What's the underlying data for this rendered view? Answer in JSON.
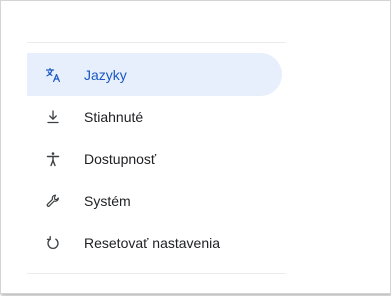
{
  "menu": {
    "items": [
      {
        "label": "Jazyky",
        "icon": "translate-icon",
        "active": true
      },
      {
        "label": "Stiahnuté",
        "icon": "download-icon",
        "active": false
      },
      {
        "label": "Dostupnosť",
        "icon": "accessibility-icon",
        "active": false
      },
      {
        "label": "Systém",
        "icon": "wrench-icon",
        "active": false
      },
      {
        "label": "Resetovať nastavenia",
        "icon": "reset-icon",
        "active": false
      }
    ]
  },
  "colors": {
    "accent": "#1a57c4",
    "active_background": "#e7effc",
    "text": "#202124"
  }
}
